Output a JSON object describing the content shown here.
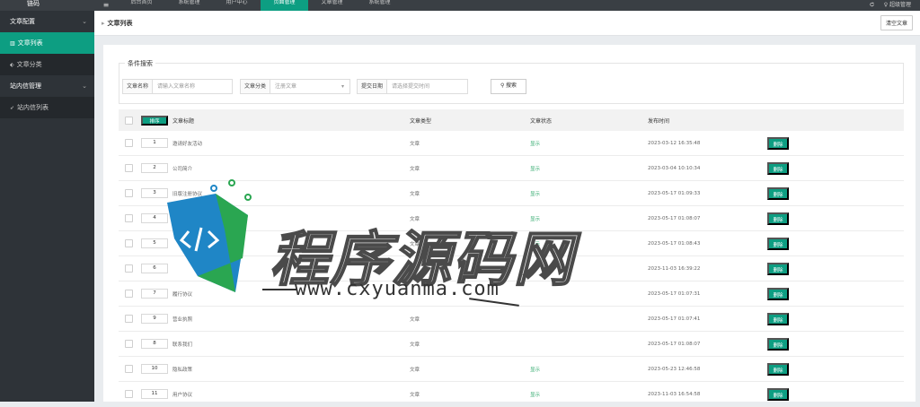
{
  "app": {
    "brand": "链码",
    "menu_toggle_icon": "≡",
    "top_nav": [
      "后台首页",
      "系统管理",
      "用户中心",
      "页面管理",
      "文章管理",
      "系统管理"
    ],
    "top_nav_active_index": 3,
    "refresh_icon": "refresh-icon",
    "admin_label": "♀ 超级管理"
  },
  "sidebar": {
    "groups": [
      {
        "label": "文章配置",
        "items": [
          {
            "label": "文章列表",
            "icon": "list-icon",
            "active": true
          },
          {
            "label": "文章分类",
            "icon": "tag-icon",
            "active": false
          }
        ]
      },
      {
        "label": "站内信管理",
        "items": [
          {
            "label": "站内信列表",
            "icon": "send-icon",
            "active": false
          }
        ]
      }
    ]
  },
  "header": {
    "breadcrumb_title": "文章列表",
    "clear_button": "清空文章"
  },
  "search": {
    "legend": "条件搜索",
    "name_label": "文章名称",
    "name_placeholder": "请输入文章名称",
    "category_label": "文章分类",
    "category_value": "注册文章",
    "time_label": "提交日期",
    "time_placeholder": "请选择提交时间",
    "button": "搜索"
  },
  "table": {
    "sort_button": "排序",
    "headers": [
      "文章标题",
      "文章类型",
      "文章状态",
      "发布时间"
    ],
    "rows": [
      {
        "sort": "1",
        "title": "邀请好友活动",
        "type": "文章",
        "status": "显示",
        "time": "2023-03-12 16:35:48",
        "action": "删除"
      },
      {
        "sort": "2",
        "title": "公司简介",
        "type": "文章",
        "status": "显示",
        "time": "2023-03-04 10:10:34",
        "action": "删除"
      },
      {
        "sort": "3",
        "title": "旧版注册协议",
        "type": "文章",
        "status": "显示",
        "time": "2023-05-17 01:09:33",
        "action": "删除"
      },
      {
        "sort": "4",
        "title": "",
        "type": "文章",
        "status": "显示",
        "time": "2023-05-17 01:08:07",
        "action": "删除"
      },
      {
        "sort": "5",
        "title": "",
        "type": "文章",
        "status": "显示",
        "time": "2023-05-17 01:08:43",
        "action": "删除"
      },
      {
        "sort": "6",
        "title": "",
        "type": "",
        "status": "",
        "time": "2023-11-03 16:39:22",
        "action": "删除"
      },
      {
        "sort": "7",
        "title": "履行协议",
        "type": "",
        "status": "",
        "time": "2023-05-17 01:07:31",
        "action": "删除"
      },
      {
        "sort": "9",
        "title": "营业执照",
        "type": "文章",
        "status": "",
        "time": "2023-05-17 01:07:41",
        "action": "删除"
      },
      {
        "sort": "8",
        "title": "联系我们",
        "type": "文章",
        "status": "",
        "time": "2023-05-17 01:08:07",
        "action": "删除"
      },
      {
        "sort": "10",
        "title": "隐私政策",
        "type": "文章",
        "status": "显示",
        "time": "2023-05-23 12:46:58",
        "action": "删除"
      },
      {
        "sort": "11",
        "title": "用户协议",
        "type": "文章",
        "status": "显示",
        "time": "2023-11-03 16:54:58",
        "action": "删除"
      }
    ]
  },
  "watermark": {
    "title": "程序源码网",
    "url": "www.cxyuanma.com"
  },
  "colors": {
    "accent": "#0d9e82",
    "sidebar": "#2e3338",
    "topbar": "#3a3f44",
    "status_green": "#2ca86a"
  }
}
